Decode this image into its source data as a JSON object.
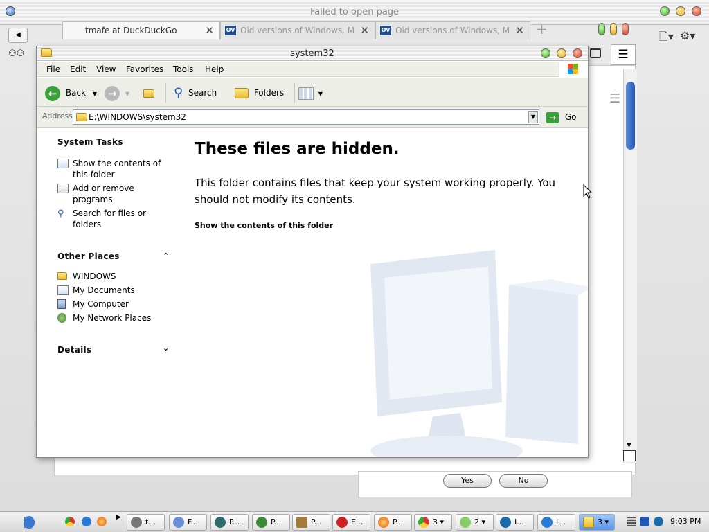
{
  "browser": {
    "window_title": "Failed to open page",
    "tabs": [
      {
        "label": "tmafe at DuckDuckGo",
        "active": true
      },
      {
        "label": "Old versions of Windows, M",
        "active": false
      },
      {
        "label": "Old versions of Windows, M",
        "active": false
      }
    ],
    "new_tab": "+",
    "back_label": "◀",
    "dialog": {
      "yes": "Yes",
      "no": "No"
    }
  },
  "explorer": {
    "title": "system32",
    "menu": [
      "File",
      "Edit",
      "View",
      "Favorites",
      "Tools",
      "Help"
    ],
    "toolbar": {
      "back": "Back",
      "search": "Search",
      "folders": "Folders"
    },
    "address": {
      "label": "Address",
      "value": "E:\\WINDOWS\\system32",
      "go": "Go"
    },
    "system_tasks": {
      "title": "System Tasks",
      "items": [
        "Show the contents of this folder",
        "Add or remove programs",
        "Search for files or folders"
      ]
    },
    "other_places": {
      "title": "Other Places",
      "items": [
        "WINDOWS",
        "My Documents",
        "My Computer",
        "My Network Places"
      ]
    },
    "details": {
      "title": "Details"
    },
    "main": {
      "heading": "These files are hidden.",
      "description": "This folder contains files that keep your system working properly. You should not modify its contents.",
      "show_link": "Show the contents of this folder"
    }
  },
  "taskbar": {
    "buttons": [
      "t...",
      "F...",
      "P...",
      "P...",
      "P...",
      "E...",
      "P...",
      "3",
      "2",
      "I...",
      "I...",
      "3"
    ],
    "clock": "9:03 PM"
  },
  "colors": {
    "accent_blue": "#2458b8",
    "folder_yellow": "#e8b92c",
    "go_green": "#3aa03a"
  }
}
